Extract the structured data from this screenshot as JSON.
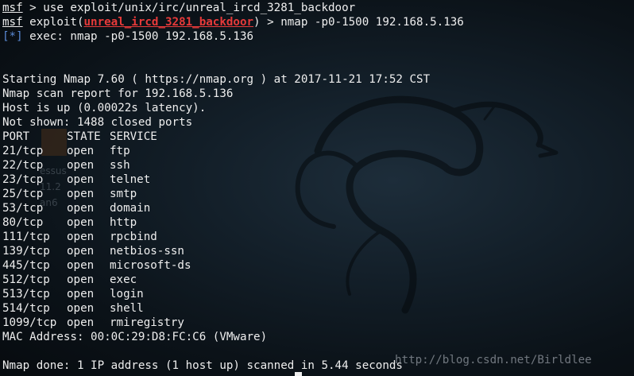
{
  "lines": [
    {
      "prompt": "msf",
      "text": " > use exploit/unix/irc/unreal_ircd_3281_backdoor"
    },
    {
      "prompt": "msf",
      "text_pre": " exploit(",
      "module": "unreal_ircd_3281_backdoor",
      "text_post": ") > nmap -p0-1500 192.168.5.136"
    },
    {
      "marker": "[*]",
      "text": " exec: nmap -p0-1500 192.168.5.136"
    },
    {
      "text": ""
    },
    {
      "text": ""
    },
    {
      "text": "Starting Nmap 7.60 ( https://nmap.org ) at 2017-11-21 17:52 CST"
    },
    {
      "text": "Nmap scan report for 192.168.5.136"
    },
    {
      "text": "Host is up (0.00022s latency)."
    },
    {
      "text": "Not shown: 1488 closed ports"
    }
  ],
  "ports_header": {
    "port": "PORT",
    "state": "STATE",
    "service": "SERVICE"
  },
  "ports": [
    {
      "port": "21/tcp",
      "state": "open",
      "service": "ftp"
    },
    {
      "port": "22/tcp",
      "state": "open",
      "service": "ssh"
    },
    {
      "port": "23/tcp",
      "state": "open",
      "service": "telnet"
    },
    {
      "port": "25/tcp",
      "state": "open",
      "service": "smtp"
    },
    {
      "port": "53/tcp",
      "state": "open",
      "service": "domain"
    },
    {
      "port": "80/tcp",
      "state": "open",
      "service": "http"
    },
    {
      "port": "111/tcp",
      "state": "open",
      "service": "rpcbind"
    },
    {
      "port": "139/tcp",
      "state": "open",
      "service": "netbios-ssn"
    },
    {
      "port": "445/tcp",
      "state": "open",
      "service": "microsoft-ds"
    },
    {
      "port": "512/tcp",
      "state": "open",
      "service": "exec"
    },
    {
      "port": "513/tcp",
      "state": "open",
      "service": "login"
    },
    {
      "port": "514/tcp",
      "state": "open",
      "service": "shell"
    },
    {
      "port": "1099/tcp",
      "state": "open",
      "service": "rmiregistry"
    }
  ],
  "mac_line": "MAC Address: 00:0C:29:D8:FC:C6 (VMware)",
  "done_line": "Nmap done: 1 IP address (1 host up) scanned in 5.44 seconds",
  "watermark": "http://blog.csdn.net/Birldlee",
  "desktop_ghost": {
    "line1": "essus",
    "line2": "11.2",
    "line3": "an6"
  },
  "colors": {
    "module": "#e83a3a",
    "marker": "#5a8ad6",
    "text": "#eeeeee",
    "background": "#131f29"
  }
}
